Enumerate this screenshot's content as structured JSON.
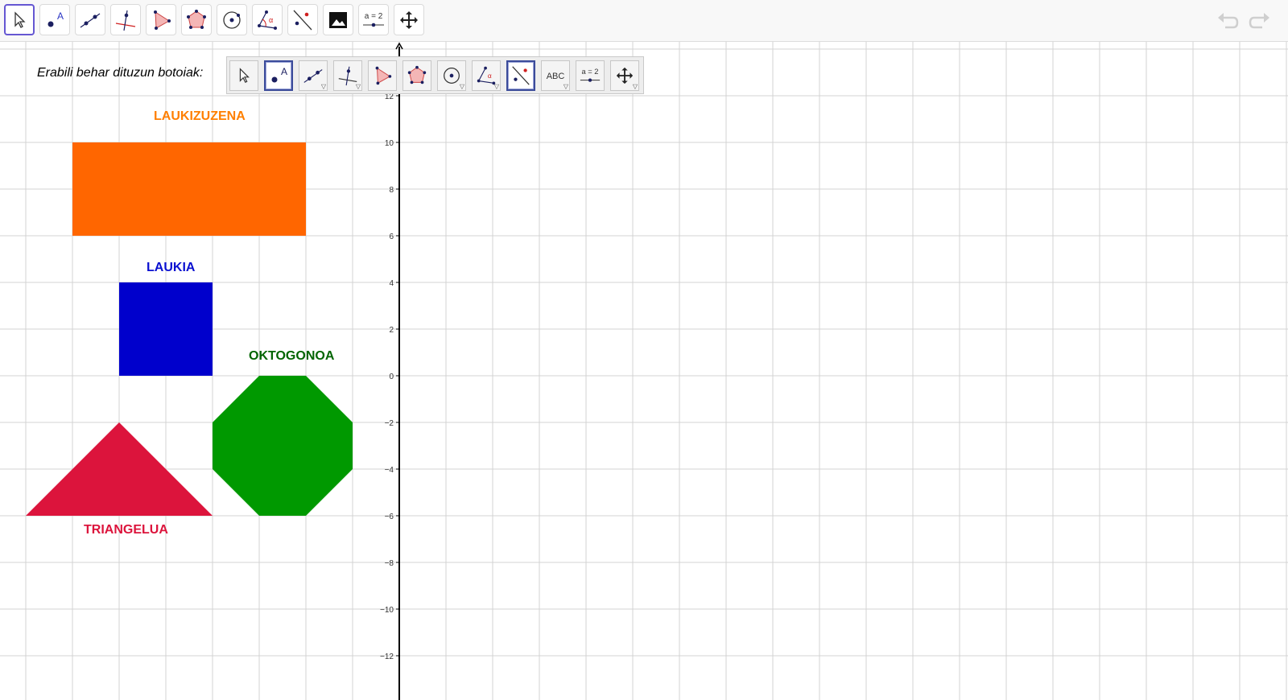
{
  "toolbar": {
    "tools": [
      {
        "name": "move-tool",
        "icon": "arrow-cursor-icon",
        "active": true
      },
      {
        "name": "point-tool",
        "icon": "point-icon"
      },
      {
        "name": "line-tool",
        "icon": "line-through-points-icon"
      },
      {
        "name": "perpendicular-tool",
        "icon": "perpendicular-line-icon"
      },
      {
        "name": "polygon-tool",
        "icon": "polygon-icon"
      },
      {
        "name": "regular-polygon-tool",
        "icon": "regular-polygon-icon"
      },
      {
        "name": "circle-tool",
        "icon": "circle-icon"
      },
      {
        "name": "angle-tool",
        "icon": "angle-icon"
      },
      {
        "name": "reflect-tool",
        "icon": "reflect-about-line-icon"
      },
      {
        "name": "image-tool",
        "icon": "image-icon"
      },
      {
        "name": "slider-tool",
        "icon": "slider-icon",
        "label": "a = 2"
      },
      {
        "name": "move-graphics-tool",
        "icon": "move-graphics-view-icon"
      }
    ],
    "undo_icon": "undo-icon",
    "redo_icon": "redo-icon"
  },
  "instruction": "Erabili behar dituzun botoiak:",
  "palette": {
    "buttons": [
      {
        "name": "palette-move",
        "icon": "arrow-cursor-icon"
      },
      {
        "name": "palette-point",
        "icon": "point-icon",
        "selected": true
      },
      {
        "name": "palette-line",
        "icon": "line-through-points-icon",
        "submenu": true
      },
      {
        "name": "palette-perpendicular",
        "icon": "perpendicular-line-icon",
        "submenu": true
      },
      {
        "name": "palette-polygon",
        "icon": "polygon-icon"
      },
      {
        "name": "palette-regular-polygon",
        "icon": "regular-polygon-icon"
      },
      {
        "name": "palette-circle",
        "icon": "circle-icon",
        "submenu": true
      },
      {
        "name": "palette-angle",
        "icon": "angle-icon",
        "submenu": true
      },
      {
        "name": "palette-reflect",
        "icon": "reflect-about-line-icon",
        "selected": true
      },
      {
        "name": "palette-text",
        "icon": "text-icon",
        "label": "ABC",
        "submenu": true
      },
      {
        "name": "palette-slider",
        "icon": "slider-icon",
        "label": "a = 2"
      },
      {
        "name": "palette-move-graphics",
        "icon": "move-graphics-view-icon",
        "submenu": true
      }
    ]
  },
  "axis": {
    "y_ticks": [
      12,
      10,
      8,
      6,
      4,
      2,
      0,
      -2,
      -4,
      -6,
      -8,
      -10,
      -12
    ],
    "y_tick_labels": [
      "12",
      "10",
      "8",
      "6",
      "4",
      "2",
      "0",
      "−2",
      "−4",
      "−6",
      "−8",
      "−10",
      "−12"
    ]
  },
  "shapes": {
    "rectangle": {
      "label": "LAUKIZUZENA",
      "color": "#ff6600",
      "vertices": [
        [
          -14,
          10
        ],
        [
          -4,
          10
        ],
        [
          -4,
          6
        ],
        [
          -14,
          6
        ]
      ]
    },
    "square": {
      "label": "LAUKIA",
      "color": "#0000cc",
      "vertices": [
        [
          -12,
          4
        ],
        [
          -8,
          4
        ],
        [
          -8,
          0
        ],
        [
          -12,
          0
        ]
      ]
    },
    "octagon": {
      "label": "OKTOGONOA",
      "color": "#009900",
      "vertices": [
        [
          -6,
          0
        ],
        [
          -4,
          0
        ],
        [
          -2,
          -2
        ],
        [
          -2,
          -4
        ],
        [
          -4,
          -6
        ],
        [
          -6,
          -6
        ],
        [
          -8,
          -4
        ],
        [
          -8,
          -2
        ]
      ]
    },
    "triangle": {
      "label": "TRIANGELUA",
      "color": "#dc143c",
      "vertices": [
        [
          -16,
          -6
        ],
        [
          -8,
          -6
        ],
        [
          -12,
          -2
        ]
      ]
    }
  }
}
